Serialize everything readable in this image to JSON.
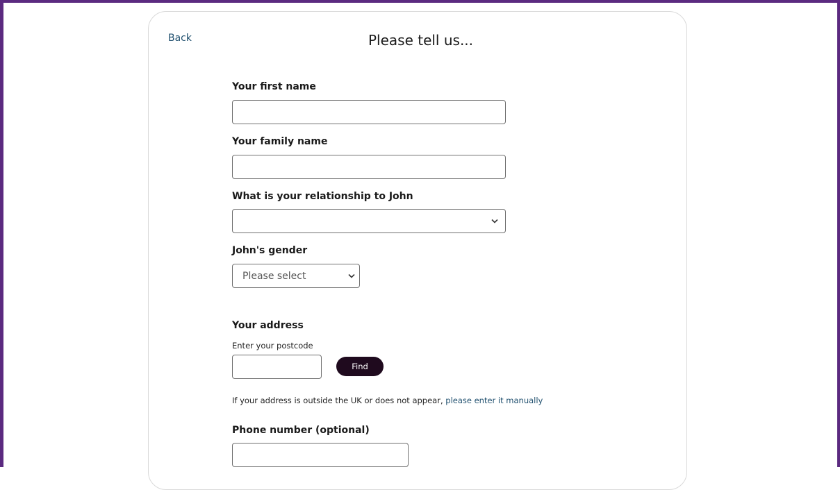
{
  "nav": {
    "back_label": "Back"
  },
  "form": {
    "title": "Please tell us...",
    "first_name": {
      "label": "Your first name",
      "value": ""
    },
    "family_name": {
      "label": "Your family name",
      "value": ""
    },
    "relationship": {
      "label": "What is your relationship to John",
      "selected": ""
    },
    "gender": {
      "label": "John's gender",
      "selected": "Please select"
    },
    "address": {
      "heading": "Your address",
      "postcode_label": "Enter your postcode",
      "postcode_value": "",
      "find_label": "Find",
      "note_text": "If your address is outside the UK or does not appear, ",
      "manual_link": "please enter it manually"
    },
    "phone": {
      "label": "Phone number (optional)",
      "value": ""
    }
  },
  "colors": {
    "frame": "#5b2a80",
    "find_button": "#1f0a1e",
    "link": "#1f4f6e"
  },
  "icons": {
    "select_arrow": "chevron-down-icon"
  }
}
